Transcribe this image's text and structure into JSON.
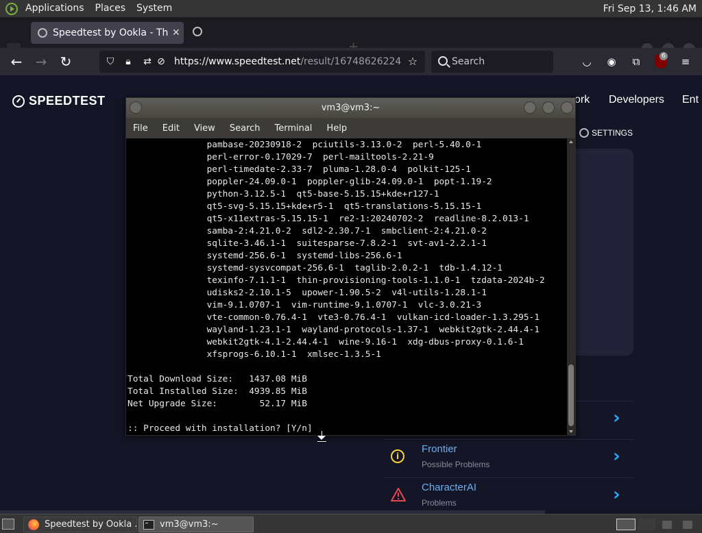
{
  "top_panel": {
    "menus": [
      "Applications",
      "Places",
      "System"
    ],
    "clock": "Fri Sep 13,  1:46 AM"
  },
  "browser": {
    "tab_title": "Speedtest by Ookla - The G",
    "url_host": "https://www.speedtest.net",
    "url_path": "/result/16748626224",
    "search_placeholder": "Search",
    "extension_badge": "6"
  },
  "page": {
    "logo_text": "SPEEDTEST",
    "nav_items": [
      "ork",
      "Developers",
      "Ent"
    ],
    "settings_label": "SETTINGS",
    "problems": [
      {
        "title": "Frontier",
        "subtitle": "Possible Problems",
        "icon": "info-icon"
      },
      {
        "title": "CharacterAI",
        "subtitle": "Problems",
        "icon": "warning-icon"
      }
    ]
  },
  "terminal": {
    "title": "vm3@vm3:~",
    "menus": [
      "File",
      "Edit",
      "View",
      "Search",
      "Terminal",
      "Help"
    ],
    "lines": [
      "               pambase-20230918-2  pciutils-3.13.0-2  perl-5.40.0-1",
      "               perl-error-0.17029-7  perl-mailtools-2.21-9",
      "               perl-timedate-2.33-7  pluma-1.28.0-4  polkit-125-1",
      "               poppler-24.09.0-1  poppler-glib-24.09.0-1  popt-1.19-2",
      "               python-3.12.5-1  qt5-base-5.15.15+kde+r127-1",
      "               qt5-svg-5.15.15+kde+r5-1  qt5-translations-5.15.15-1",
      "               qt5-x11extras-5.15.15-1  re2-1:20240702-2  readline-8.2.013-1",
      "               samba-2:4.21.0-2  sdl2-2.30.7-1  smbclient-2:4.21.0-2",
      "               sqlite-3.46.1-1  suitesparse-7.8.2-1  svt-av1-2.2.1-1",
      "               systemd-256.6-1  systemd-libs-256.6-1",
      "               systemd-sysvcompat-256.6-1  taglib-2.0.2-1  tdb-1.4.12-1",
      "               texinfo-7.1.1-1  thin-provisioning-tools-1.1.0-1  tzdata-2024b-2",
      "               udisks2-2.10.1-5  upower-1.90.5-2  v4l-utils-1.28.1-1",
      "               vim-9.1.0707-1  vim-runtime-9.1.0707-1  vlc-3.0.21-3",
      "               vte-common-0.76.4-1  vte3-0.76.4-1  vulkan-icd-loader-1.3.295-1",
      "               wayland-1.23.1-1  wayland-protocols-1.37-1  webkit2gtk-2.44.4-1",
      "               webkit2gtk-4.1-2.44.4-1  wine-9.16-1  xdg-dbus-proxy-0.1.6-1",
      "               xfsprogs-6.10.1-1  xmlsec-1.3.5-1",
      "",
      "Total Download Size:   1437.08 MiB",
      "Total Installed Size:  4939.85 MiB",
      "Net Upgrade Size:        52.17 MiB",
      "",
      ":: Proceed with installation? [Y/n]"
    ]
  },
  "taskbar": {
    "tasks": [
      "Speedtest by Ookla ...",
      "vm3@vm3:~"
    ]
  }
}
